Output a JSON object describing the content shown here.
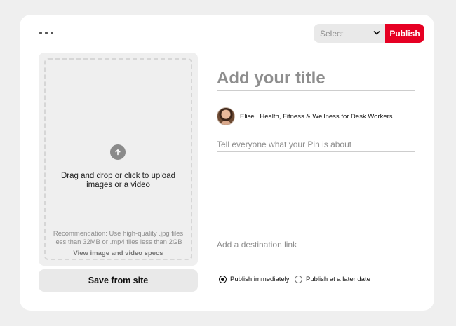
{
  "toolbar": {
    "more_icon": "ellipsis-icon",
    "select_label": "Select",
    "select_icon": "chevron-down-icon",
    "publish_label": "Publish",
    "publish_color": "#e60023"
  },
  "upload": {
    "icon": "arrow-up-circle-icon",
    "drag_text": "Drag and drop or click to upload images or a video",
    "recommendation": "Recommendation: Use high-quality .jpg files less than 32MB or .mp4 files less than 2GB",
    "specs_link": "View image and video specs"
  },
  "save_from_site_label": "Save from site",
  "form": {
    "title_placeholder": "Add your title",
    "title_value": "",
    "author_name": "Elise | Health, Fitness & Wellness for Desk Workers",
    "description_placeholder": "Tell everyone what your Pin is about",
    "description_value": "",
    "link_placeholder": "Add a destination link",
    "link_value": ""
  },
  "publish_options": {
    "immediately_label": "Publish immediately",
    "later_label": "Publish at a later date",
    "selected": "immediately"
  }
}
